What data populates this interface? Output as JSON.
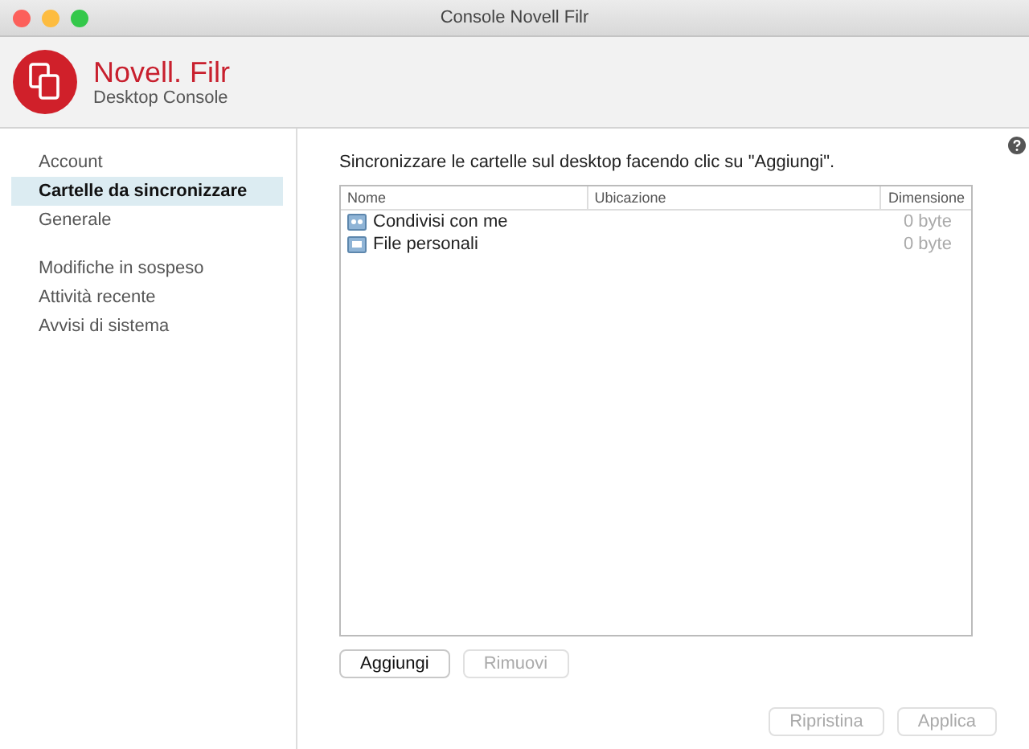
{
  "window": {
    "title": "Console Novell Filr"
  },
  "header": {
    "brand": "Novell. Filr",
    "subtitle": "Desktop Console"
  },
  "sidebar": {
    "groups": [
      {
        "items": [
          {
            "label": "Account",
            "selected": false
          },
          {
            "label": "Cartelle da sincronizzare",
            "selected": true
          },
          {
            "label": "Generale",
            "selected": false
          }
        ]
      },
      {
        "items": [
          {
            "label": "Modifiche in sospeso",
            "selected": false
          },
          {
            "label": "Attività recente",
            "selected": false
          },
          {
            "label": "Avvisi di sistema",
            "selected": false
          }
        ]
      }
    ]
  },
  "main": {
    "instruction": "Sincronizzare le cartelle sul desktop facendo clic su \"Aggiungi\".",
    "table": {
      "columns": [
        "Nome",
        "Ubicazione",
        "Dimensione"
      ],
      "rows": [
        {
          "name": "Condivisi con me",
          "size": "0 byte",
          "kind": "shared"
        },
        {
          "name": "File personali",
          "size": "0 byte",
          "kind": "personal"
        }
      ]
    },
    "list_buttons": [
      {
        "label": "Aggiungi",
        "disabled": false
      },
      {
        "label": "Rimuovi",
        "disabled": true
      }
    ],
    "footer_buttons": [
      {
        "label": "Ripristina",
        "disabled": true
      },
      {
        "label": "Applica",
        "disabled": true
      }
    ]
  }
}
